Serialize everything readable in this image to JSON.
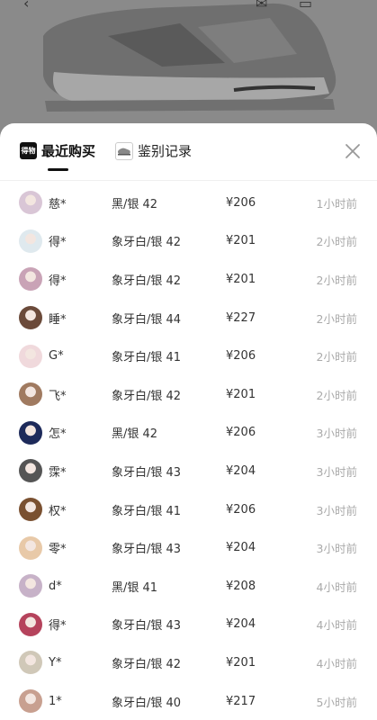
{
  "tabs": {
    "recent_label": "最近购买",
    "recent_icon_text": "得物",
    "auth_label": "鉴别记录"
  },
  "records": [
    {
      "user": "慈*",
      "spec": "黑/银 42",
      "price": "¥206",
      "time": "1小时前",
      "avatar_color": "#d9c6d6"
    },
    {
      "user": "得*",
      "spec": "象牙白/银 42",
      "price": "¥201",
      "time": "2小时前",
      "avatar_color": "#dfe9ee"
    },
    {
      "user": "得*",
      "spec": "象牙白/银 42",
      "price": "¥201",
      "time": "2小时前",
      "avatar_color": "#c9a3b6"
    },
    {
      "user": "睡*",
      "spec": "象牙白/银 44",
      "price": "¥227",
      "time": "2小时前",
      "avatar_color": "#6b4a3a"
    },
    {
      "user": "G*",
      "spec": "象牙白/银 41",
      "price": "¥206",
      "time": "2小时前",
      "avatar_color": "#f0d9dc"
    },
    {
      "user": "飞*",
      "spec": "象牙白/银 42",
      "price": "¥201",
      "time": "2小时前",
      "avatar_color": "#a07a60"
    },
    {
      "user": "怎*",
      "spec": "黑/银 42",
      "price": "¥206",
      "time": "3小时前",
      "avatar_color": "#1d2a5a"
    },
    {
      "user": "霂*",
      "spec": "象牙白/银 43",
      "price": "¥204",
      "time": "3小时前",
      "avatar_color": "#555555"
    },
    {
      "user": "权*",
      "spec": "象牙白/银 41",
      "price": "¥206",
      "time": "3小时前",
      "avatar_color": "#7a5030"
    },
    {
      "user": "零*",
      "spec": "象牙白/银 43",
      "price": "¥204",
      "time": "3小时前",
      "avatar_color": "#e8c9a8"
    },
    {
      "user": "d*",
      "spec": "黑/银 41",
      "price": "¥208",
      "time": "4小时前",
      "avatar_color": "#c7b2c8"
    },
    {
      "user": "得*",
      "spec": "象牙白/银 43",
      "price": "¥204",
      "time": "4小时前",
      "avatar_color": "#b5435c"
    },
    {
      "user": "Y*",
      "spec": "象牙白/银 42",
      "price": "¥201",
      "time": "4小时前",
      "avatar_color": "#d0c8b8"
    },
    {
      "user": "1*",
      "spec": "象牙白/银 40",
      "price": "¥217",
      "time": "5小时前",
      "avatar_color": "#c8a090"
    }
  ]
}
